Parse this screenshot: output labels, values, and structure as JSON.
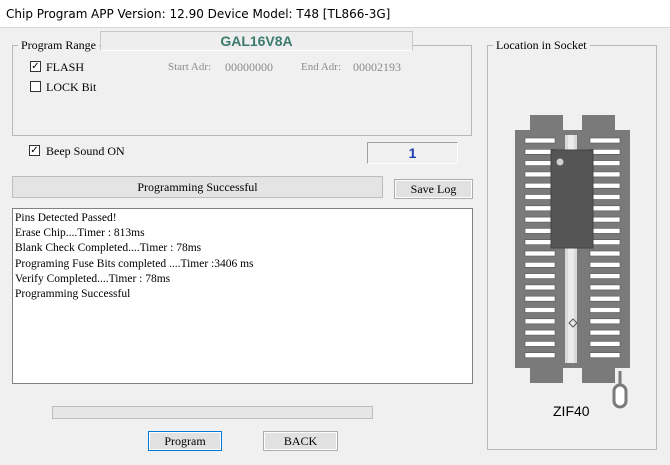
{
  "window": {
    "title": "Chip Program",
    "subtitle": "APP Version: 12.90 Device Model: T48 [TL866-3G]"
  },
  "program_range": {
    "title": "Program Range",
    "chip_name": "GAL16V8A",
    "flash": {
      "label": "FLASH",
      "checked": true
    },
    "lock_bit": {
      "label": "LOCK Bit",
      "checked": false
    },
    "start_adr_label": "Start Adr:",
    "start_adr_value": "00000000",
    "end_adr_label": "End Adr:",
    "end_adr_value": "00002193"
  },
  "beep": {
    "label": "Beep Sound ON",
    "checked": true
  },
  "counter": "1",
  "status": "Programming Successful",
  "save_log_label": "Save Log",
  "log_lines": [
    "Pins Detected Passed!",
    "Erase Chip....Timer : 813ms",
    "Blank Check Completed....Timer : 78ms",
    "Programing Fuse Bits completed ....Timer :3406 ms",
    "Verify Completed....Timer : 78ms",
    "Programming Successful"
  ],
  "progress": 0,
  "socket": {
    "title": "Location in Socket",
    "label": "ZIF40"
  },
  "buttons": {
    "program": "Program",
    "back": "BACK"
  },
  "colors": {
    "chip_name": "#3c7a6e",
    "counter": "#1f3fb3",
    "socket_body": "#7a7a7a",
    "chip": "#555555"
  }
}
